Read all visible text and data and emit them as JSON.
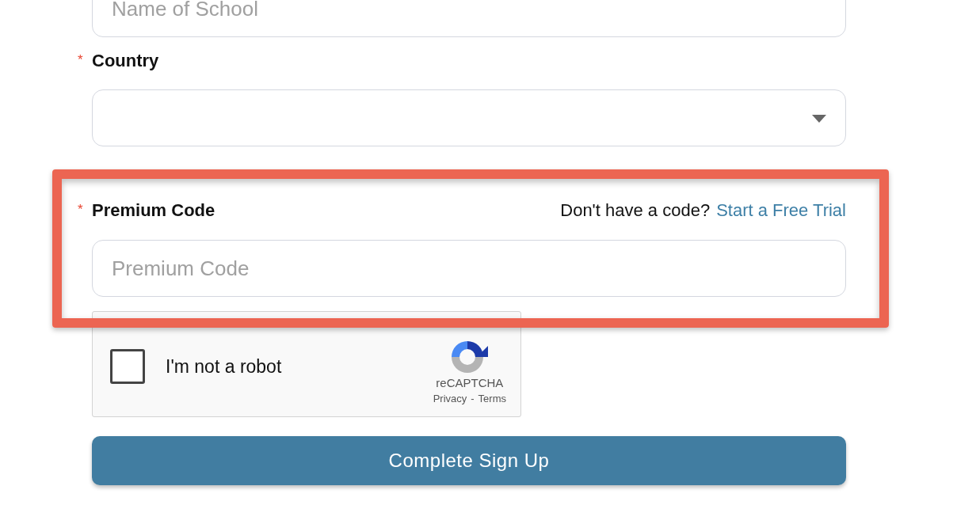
{
  "fields": [
    {
      "kind": "text",
      "placeholder": "Name of School"
    },
    {
      "kind": "select",
      "label": "Country",
      "required_mark": "*"
    },
    {
      "kind": "text",
      "label": "Premium Code",
      "required_mark": "*",
      "placeholder": "Premium Code",
      "hint": "Don't have a code?",
      "link": "Start a Free Trial",
      "highlighted": true
    }
  ],
  "captcha": {
    "label": "I'm not a robot",
    "checked": false,
    "brand": "reCAPTCHA",
    "privacy": "Privacy",
    "separator": "-",
    "terms": "Terms"
  },
  "submit": "Complete Sign Up"
}
